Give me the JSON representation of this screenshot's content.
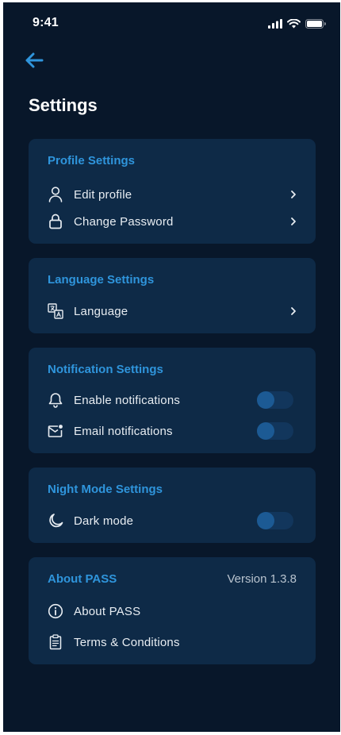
{
  "status_bar": {
    "time": "9:41",
    "icons": [
      "signal-icon",
      "wifi-icon",
      "battery-icon"
    ]
  },
  "header": {
    "back_icon": "arrow-left-icon",
    "title": "Settings"
  },
  "colors": {
    "background": "#08172a",
    "card": "#0e2a47",
    "accent": "#2f95dc",
    "text": "#e8edf2",
    "toggle_track": "#12365c",
    "toggle_knob": "#1c5a94"
  },
  "sections": {
    "profile": {
      "title": "Profile Settings",
      "items": [
        {
          "label": "Edit profile",
          "icon": "user-icon",
          "control": "chevron"
        },
        {
          "label": "Change Password",
          "icon": "lock-icon",
          "control": "chevron"
        }
      ]
    },
    "language": {
      "title": "Language Settings",
      "items": [
        {
          "label": "Language",
          "icon": "translate-icon",
          "control": "chevron"
        }
      ]
    },
    "notification": {
      "title": "Notification Settings",
      "items": [
        {
          "label": "Enable notifications",
          "icon": "bell-icon",
          "control": "toggle",
          "on": false
        },
        {
          "label": "Email notifications",
          "icon": "mail-icon",
          "control": "toggle",
          "on": false
        }
      ]
    },
    "night_mode": {
      "title": "Night Mode Settings",
      "items": [
        {
          "label": "Dark mode",
          "icon": "moon-icon",
          "control": "toggle",
          "on": false
        }
      ]
    },
    "about": {
      "title": "About PASS",
      "version": "Version 1.3.8",
      "items": [
        {
          "label": "About PASS",
          "icon": "info-icon"
        },
        {
          "label": "Terms & Conditions",
          "icon": "document-icon"
        }
      ]
    }
  }
}
